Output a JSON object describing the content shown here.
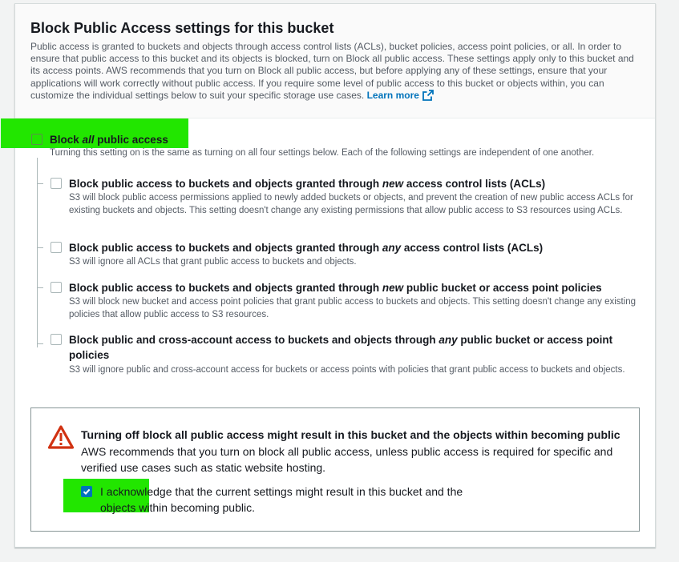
{
  "section": {
    "title": "Block Public Access settings for this bucket",
    "description": "Public access is granted to buckets and objects through access control lists (ACLs), bucket policies, access point policies, or all. In order to ensure that public access to this bucket and its objects is blocked, turn on Block all public access. These settings apply only to this bucket and its access points. AWS recommends that you turn on Block all public access, but before applying any of these settings, ensure that your applications will work correctly without public access. If you require some level of public access to this bucket or objects within, you can customize the individual settings below to suit your specific storage use cases.",
    "learn_more": "Learn more"
  },
  "block_all": {
    "label_pre": "Block ",
    "label_em": "all",
    "label_post": " public access",
    "description": "Turning this setting on is the same as turning on all four settings below. Each of the following settings are independent of one another.",
    "checked": false
  },
  "options": [
    {
      "label_pre": "Block public access to buckets and objects granted through ",
      "label_em": "new",
      "label_post": " access control lists (ACLs)",
      "description": "S3 will block public access permissions applied to newly added buckets or objects, and prevent the creation of new public access ACLs for existing buckets and objects. This setting doesn't change any existing permissions that allow public access to S3 resources using ACLs.",
      "checked": false
    },
    {
      "label_pre": "Block public access to buckets and objects granted through ",
      "label_em": "any",
      "label_post": " access control lists (ACLs)",
      "description": "S3 will ignore all ACLs that grant public access to buckets and objects.",
      "checked": false
    },
    {
      "label_pre": "Block public access to buckets and objects granted through ",
      "label_em": "new",
      "label_post": " public bucket or access point policies",
      "description": "S3 will block new bucket and access point policies that grant public access to buckets and objects. This setting doesn't change any existing policies that allow public access to S3 resources.",
      "checked": false
    },
    {
      "label_pre": "Block public and cross-account access to buckets and objects through ",
      "label_em": "any",
      "label_post": " public bucket or access point policies",
      "description": "S3 will ignore public and cross-account access for buckets or access points with policies that grant public access to buckets and objects.",
      "checked": false
    }
  ],
  "warning": {
    "title": "Turning off block all public access might result in this bucket and the objects within becoming public",
    "text": "AWS recommends that you turn on block all public access, unless public access is required for specific and verified use cases such as static website hosting.",
    "ack_label": "I acknowledge that the current settings might result in this bucket and the objects within becoming public.",
    "ack_checked": true
  },
  "colors": {
    "highlight": "#22e600",
    "link": "#0073bb",
    "warning": "#d13212"
  },
  "icons": {
    "external_link": "external-link-icon",
    "warning": "warning-triangle-icon",
    "check": "check-icon"
  }
}
